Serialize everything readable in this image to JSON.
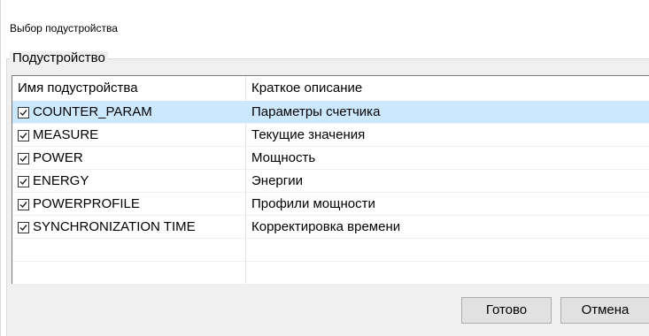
{
  "window": {
    "title": "Выбор подустройства"
  },
  "group": {
    "label": "Подустройство"
  },
  "list": {
    "columns": [
      "Имя подустройства",
      "Краткое описание"
    ],
    "rows": [
      {
        "name": "COUNTER_PARAM",
        "description": "Параметры счетчика",
        "checked": true,
        "selected": true
      },
      {
        "name": "MEASURE",
        "description": "Текущие значения",
        "checked": true,
        "selected": false
      },
      {
        "name": "POWER",
        "description": "Мощность",
        "checked": true,
        "selected": false
      },
      {
        "name": "ENERGY",
        "description": "Энергии",
        "checked": true,
        "selected": false
      },
      {
        "name": "POWERPROFILE",
        "description": "Профили мощности",
        "checked": true,
        "selected": false
      },
      {
        "name": "SYNCHRONIZATION TIME",
        "description": "Корректировка времени",
        "checked": true,
        "selected": false
      }
    ]
  },
  "buttons": {
    "ok": "Готово",
    "cancel": "Отмена"
  },
  "colors": {
    "selection": "#cce8ff",
    "panel": "#f0f0f0",
    "button": "#e1e1e1"
  }
}
